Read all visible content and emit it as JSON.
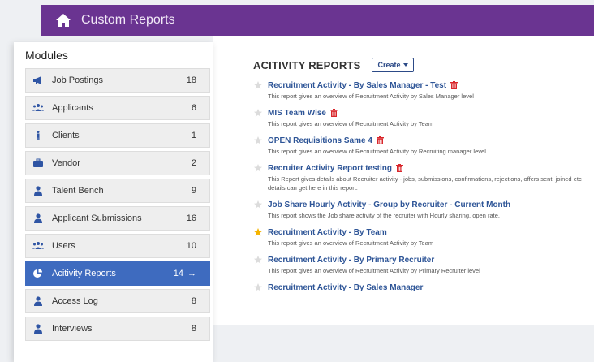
{
  "header": {
    "title": "Custom Reports",
    "icon": "home-icon"
  },
  "modules": {
    "title": "Modules",
    "items": [
      {
        "label": "Job Postings",
        "count": "18",
        "icon": "megaphone-icon"
      },
      {
        "label": "Applicants",
        "count": "6",
        "icon": "users-group-icon"
      },
      {
        "label": "Clients",
        "count": "1",
        "icon": "person-standing-icon"
      },
      {
        "label": "Vendor",
        "count": "2",
        "icon": "briefcase-icon"
      },
      {
        "label": "Talent Bench",
        "count": "9",
        "icon": "user-icon"
      },
      {
        "label": "Applicant Submissions",
        "count": "16",
        "icon": "user-icon"
      },
      {
        "label": "Users",
        "count": "10",
        "icon": "users-group-icon"
      },
      {
        "label": "Acitivity Reports",
        "count": "14",
        "icon": "pie-chart-icon",
        "active": true
      },
      {
        "label": "Access Log",
        "count": "8",
        "icon": "user-icon"
      },
      {
        "label": "Interviews",
        "count": "8",
        "icon": "user-icon"
      }
    ]
  },
  "reports": {
    "heading": "ACITIVITY REPORTS",
    "create_label": "Create",
    "items": [
      {
        "title": "Recruitment Activity - By Sales Manager - Test",
        "desc": "This report gives an overview of Recruitment Activity by Sales Manager level",
        "starred": false,
        "deletable": true
      },
      {
        "title": "MIS Team Wise",
        "desc": "This report gives an overview of Recruitment Activity by Team",
        "starred": false,
        "deletable": true
      },
      {
        "title": "OPEN Requisitions Same 4",
        "desc": "This report gives an overview of Recruitment Activity by Recruiting manager level",
        "starred": false,
        "deletable": true
      },
      {
        "title": "Recruiter Activity Report testing",
        "desc": "This Report gives details about Recruiter activity - jobs, submissions, confirmations, rejections, offers sent, joined etc details can get here in this report.",
        "starred": false,
        "deletable": true
      },
      {
        "title": "Job Share Hourly Activity - Group by Recruiter - Current Month",
        "desc": "This report shows the Job share activity of the recruiter with Hourly sharing, open rate.",
        "starred": false,
        "deletable": false
      },
      {
        "title": "Recruitment Activity - By Team",
        "desc": "This report gives an overview of Recruitment Activity by Team",
        "starred": true,
        "deletable": false
      },
      {
        "title": "Recruitment Activity - By Primary Recruiter",
        "desc": "This report gives an overview of Recruitment Activity by Primary Recruiter level",
        "starred": false,
        "deletable": false
      },
      {
        "title": "Recruitment Activity - By Sales Manager",
        "desc": "",
        "starred": false,
        "deletable": false
      }
    ]
  },
  "colors": {
    "header_bg": "#6a3491",
    "active_module": "#3e6bbf",
    "link": "#2e5597",
    "trash": "#d9262b",
    "star_on": "#f5b400",
    "star_off": "#dcdcdc"
  }
}
